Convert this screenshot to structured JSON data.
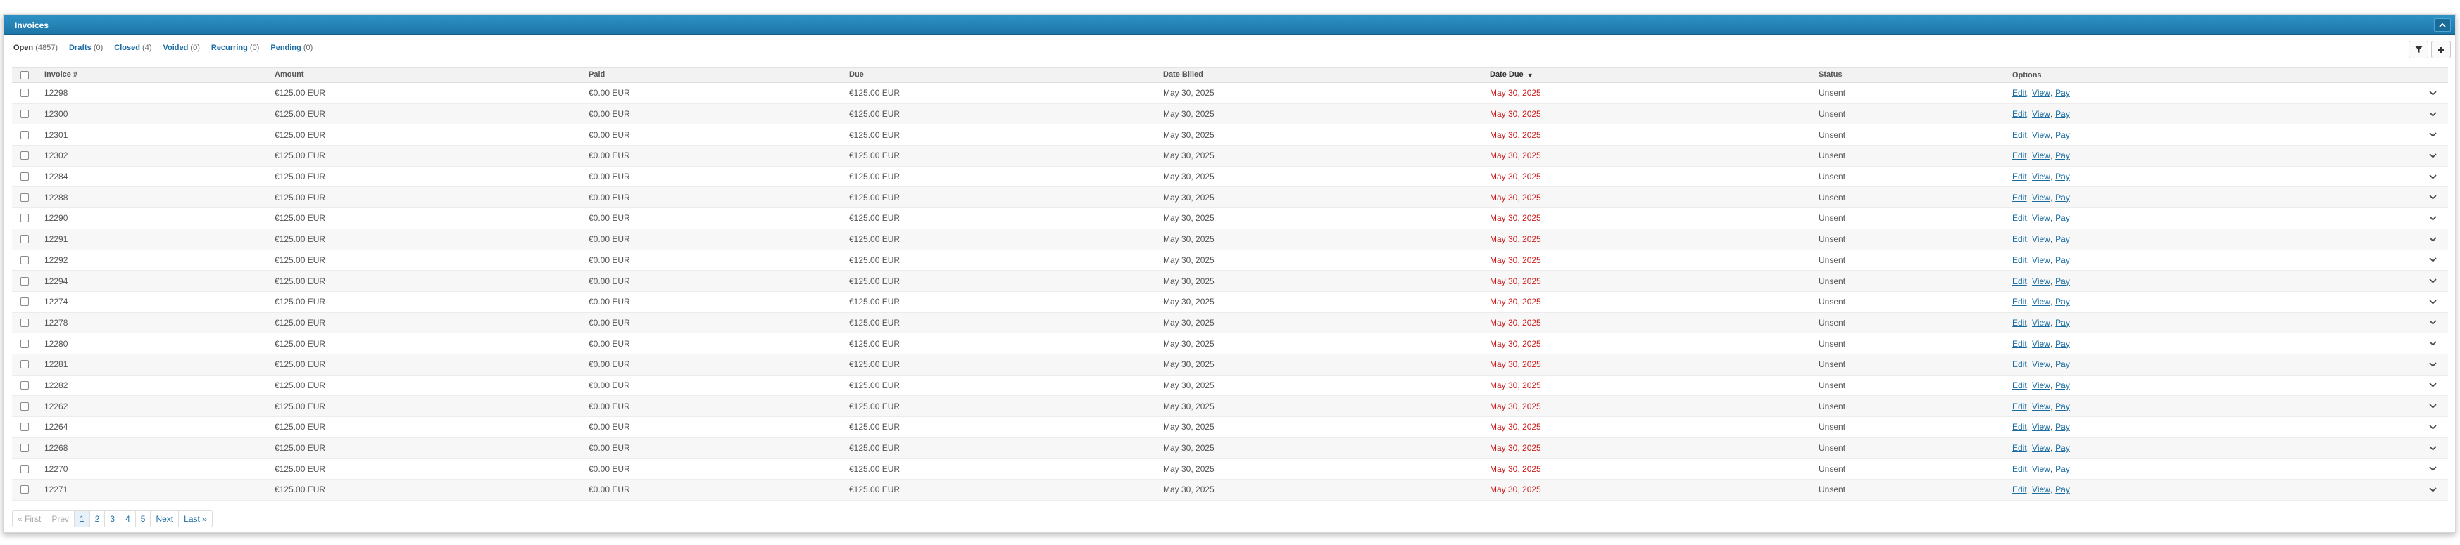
{
  "panel": {
    "title": "Invoices"
  },
  "filters": [
    {
      "label": "Open",
      "count": "(4857)"
    },
    {
      "label": "Drafts",
      "count": "(0)"
    },
    {
      "label": "Closed",
      "count": "(4)"
    },
    {
      "label": "Voided",
      "count": "(0)"
    },
    {
      "label": "Recurring",
      "count": "(0)"
    },
    {
      "label": "Pending",
      "count": "(0)"
    }
  ],
  "columns": {
    "invoice": "Invoice #",
    "amount": "Amount",
    "paid": "Paid",
    "due": "Due",
    "date_billed": "Date Billed",
    "date_due": "Date Due",
    "status": "Status",
    "options": "Options"
  },
  "option_links": {
    "edit": "Edit",
    "view": "View",
    "pay": "Pay"
  },
  "rows": [
    {
      "invoice": "12298",
      "amount": "€125.00 EUR",
      "paid": "€0.00 EUR",
      "due": "€125.00 EUR",
      "date_billed": "May 30, 2025",
      "date_due": "May 30, 2025",
      "status": "Unsent"
    },
    {
      "invoice": "12300",
      "amount": "€125.00 EUR",
      "paid": "€0.00 EUR",
      "due": "€125.00 EUR",
      "date_billed": "May 30, 2025",
      "date_due": "May 30, 2025",
      "status": "Unsent"
    },
    {
      "invoice": "12301",
      "amount": "€125.00 EUR",
      "paid": "€0.00 EUR",
      "due": "€125.00 EUR",
      "date_billed": "May 30, 2025",
      "date_due": "May 30, 2025",
      "status": "Unsent"
    },
    {
      "invoice": "12302",
      "amount": "€125.00 EUR",
      "paid": "€0.00 EUR",
      "due": "€125.00 EUR",
      "date_billed": "May 30, 2025",
      "date_due": "May 30, 2025",
      "status": "Unsent"
    },
    {
      "invoice": "12284",
      "amount": "€125.00 EUR",
      "paid": "€0.00 EUR",
      "due": "€125.00 EUR",
      "date_billed": "May 30, 2025",
      "date_due": "May 30, 2025",
      "status": "Unsent"
    },
    {
      "invoice": "12288",
      "amount": "€125.00 EUR",
      "paid": "€0.00 EUR",
      "due": "€125.00 EUR",
      "date_billed": "May 30, 2025",
      "date_due": "May 30, 2025",
      "status": "Unsent"
    },
    {
      "invoice": "12290",
      "amount": "€125.00 EUR",
      "paid": "€0.00 EUR",
      "due": "€125.00 EUR",
      "date_billed": "May 30, 2025",
      "date_due": "May 30, 2025",
      "status": "Unsent"
    },
    {
      "invoice": "12291",
      "amount": "€125.00 EUR",
      "paid": "€0.00 EUR",
      "due": "€125.00 EUR",
      "date_billed": "May 30, 2025",
      "date_due": "May 30, 2025",
      "status": "Unsent"
    },
    {
      "invoice": "12292",
      "amount": "€125.00 EUR",
      "paid": "€0.00 EUR",
      "due": "€125.00 EUR",
      "date_billed": "May 30, 2025",
      "date_due": "May 30, 2025",
      "status": "Unsent"
    },
    {
      "invoice": "12294",
      "amount": "€125.00 EUR",
      "paid": "€0.00 EUR",
      "due": "€125.00 EUR",
      "date_billed": "May 30, 2025",
      "date_due": "May 30, 2025",
      "status": "Unsent"
    },
    {
      "invoice": "12274",
      "amount": "€125.00 EUR",
      "paid": "€0.00 EUR",
      "due": "€125.00 EUR",
      "date_billed": "May 30, 2025",
      "date_due": "May 30, 2025",
      "status": "Unsent"
    },
    {
      "invoice": "12278",
      "amount": "€125.00 EUR",
      "paid": "€0.00 EUR",
      "due": "€125.00 EUR",
      "date_billed": "May 30, 2025",
      "date_due": "May 30, 2025",
      "status": "Unsent"
    },
    {
      "invoice": "12280",
      "amount": "€125.00 EUR",
      "paid": "€0.00 EUR",
      "due": "€125.00 EUR",
      "date_billed": "May 30, 2025",
      "date_due": "May 30, 2025",
      "status": "Unsent"
    },
    {
      "invoice": "12281",
      "amount": "€125.00 EUR",
      "paid": "€0.00 EUR",
      "due": "€125.00 EUR",
      "date_billed": "May 30, 2025",
      "date_due": "May 30, 2025",
      "status": "Unsent"
    },
    {
      "invoice": "12282",
      "amount": "€125.00 EUR",
      "paid": "€0.00 EUR",
      "due": "€125.00 EUR",
      "date_billed": "May 30, 2025",
      "date_due": "May 30, 2025",
      "status": "Unsent"
    },
    {
      "invoice": "12262",
      "amount": "€125.00 EUR",
      "paid": "€0.00 EUR",
      "due": "€125.00 EUR",
      "date_billed": "May 30, 2025",
      "date_due": "May 30, 2025",
      "status": "Unsent"
    },
    {
      "invoice": "12264",
      "amount": "€125.00 EUR",
      "paid": "€0.00 EUR",
      "due": "€125.00 EUR",
      "date_billed": "May 30, 2025",
      "date_due": "May 30, 2025",
      "status": "Unsent"
    },
    {
      "invoice": "12268",
      "amount": "€125.00 EUR",
      "paid": "€0.00 EUR",
      "due": "€125.00 EUR",
      "date_billed": "May 30, 2025",
      "date_due": "May 30, 2025",
      "status": "Unsent"
    },
    {
      "invoice": "12270",
      "amount": "€125.00 EUR",
      "paid": "€0.00 EUR",
      "due": "€125.00 EUR",
      "date_billed": "May 30, 2025",
      "date_due": "May 30, 2025",
      "status": "Unsent"
    },
    {
      "invoice": "12271",
      "amount": "€125.00 EUR",
      "paid": "€0.00 EUR",
      "due": "€125.00 EUR",
      "date_billed": "May 30, 2025",
      "date_due": "May 30, 2025",
      "status": "Unsent"
    }
  ],
  "pagination": {
    "first": "« First",
    "prev": "Prev",
    "pages": [
      "1",
      "2",
      "3",
      "4",
      "5"
    ],
    "current": "1",
    "next": "Next",
    "last": "Last »"
  },
  "colors": {
    "header_bar": "#1c74a6",
    "link": "#1a6ca3",
    "overdue_date": "#cc1b1b"
  },
  "icons": {
    "collapse": "chevron-up-icon",
    "filter": "filter-icon",
    "add": "plus-icon",
    "row_expand": "chevron-down-icon"
  }
}
